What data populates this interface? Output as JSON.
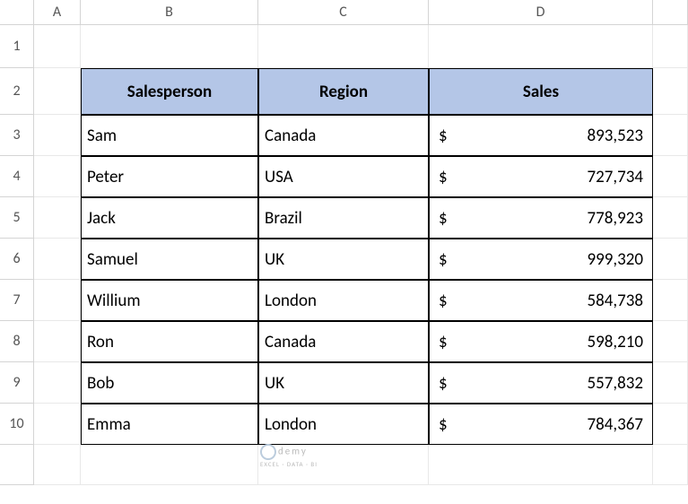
{
  "columns": [
    "A",
    "B",
    "C",
    "D"
  ],
  "rows": [
    "1",
    "2",
    "3",
    "4",
    "5",
    "6",
    "7",
    "8",
    "9",
    "10"
  ],
  "table": {
    "headers": [
      "Salesperson",
      "Region",
      "Sales"
    ],
    "rows": [
      {
        "salesperson": "Sam",
        "region": "Canada",
        "sales": "893,523"
      },
      {
        "salesperson": "Peter",
        "region": "USA",
        "sales": "727,734"
      },
      {
        "salesperson": "Jack",
        "region": "Brazil",
        "sales": "778,923"
      },
      {
        "salesperson": "Samuel",
        "region": "UK",
        "sales": "999,320"
      },
      {
        "salesperson": "Willium",
        "region": "London",
        "sales": "584,738"
      },
      {
        "salesperson": "Ron",
        "region": "Canada",
        "sales": "598,210"
      },
      {
        "salesperson": "Bob",
        "region": "UK",
        "sales": "557,832"
      },
      {
        "salesperson": "Emma",
        "region": "London",
        "sales": "784,367"
      }
    ],
    "currency": "$"
  },
  "watermark": {
    "main": "demy",
    "sub": "EXCEL · DATA · BI"
  }
}
